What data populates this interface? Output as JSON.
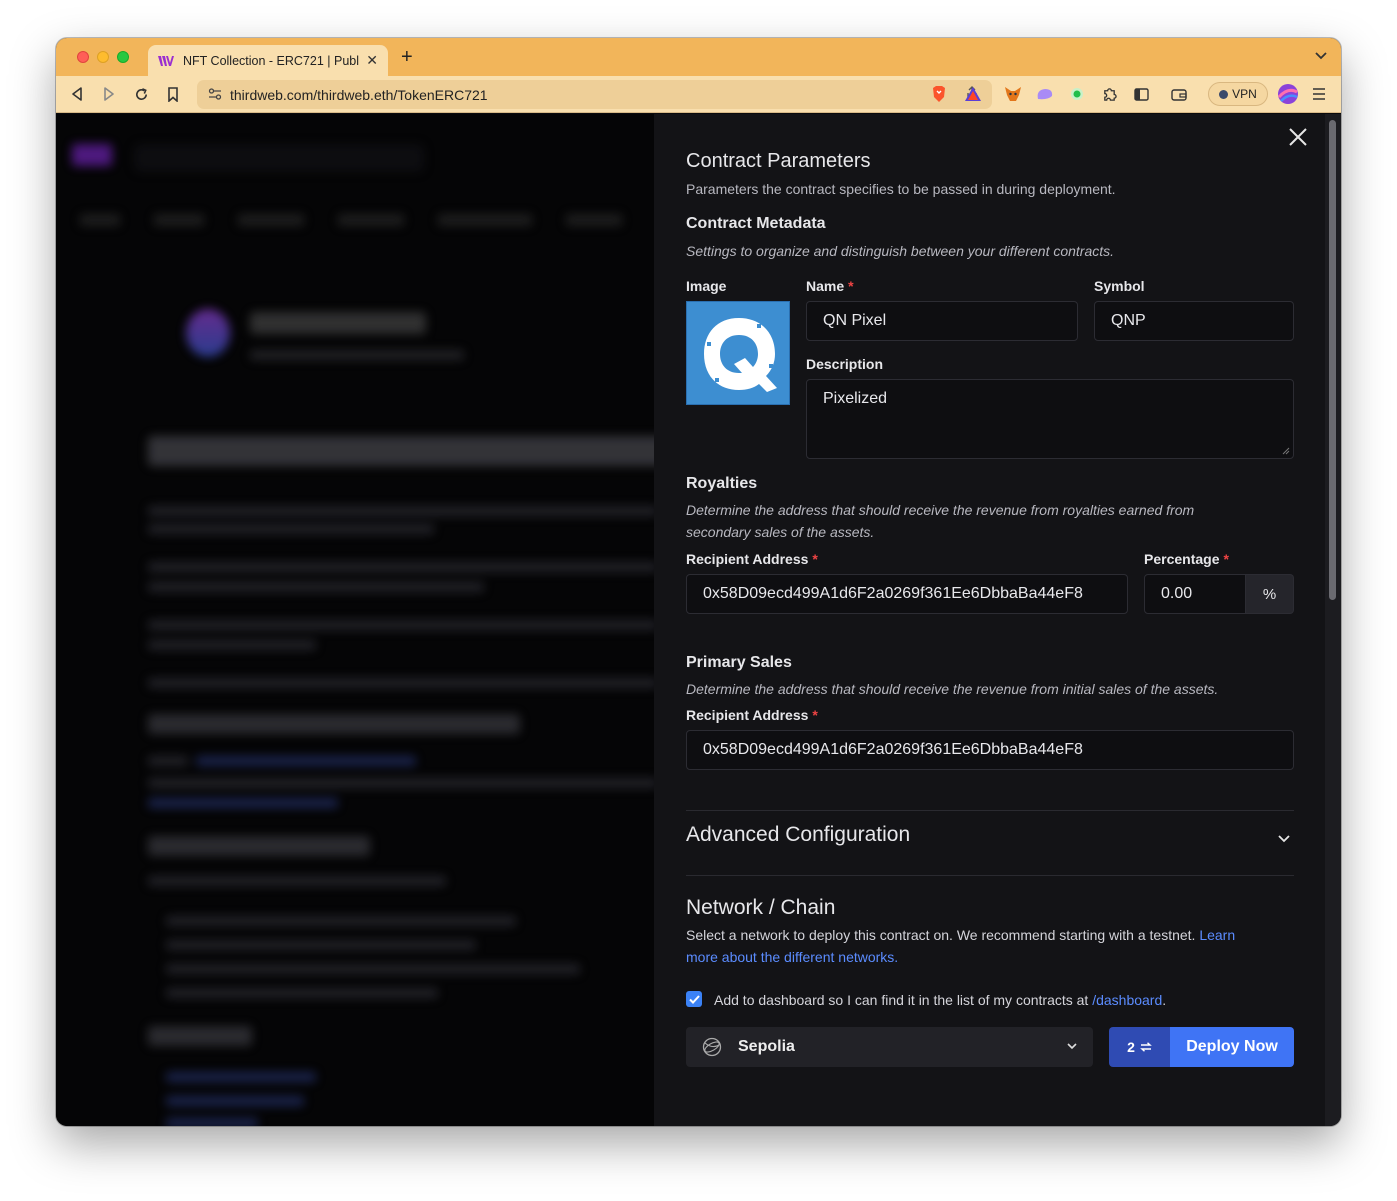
{
  "browser": {
    "tab_title": "NFT Collection - ERC721 | Publ",
    "url": "thirdweb.com/thirdweb.eth/TokenERC721",
    "vpn_label": "VPN"
  },
  "colors": {
    "tabstrip": "#f2b55a",
    "drawer_bg": "#131316",
    "primary_button": "#3f74f5",
    "link": "#5b8cff",
    "required": "#ef4444"
  },
  "drawer": {
    "title": "Contract Parameters",
    "subtitle": "Parameters the contract specifies to be passed in during deployment.",
    "metadata": {
      "title": "Contract Metadata",
      "description": "Settings to organize and distinguish between your different contracts.",
      "image_label": "Image",
      "name_label": "Name",
      "name_value": "QN Pixel",
      "symbol_label": "Symbol",
      "symbol_value": "QNP",
      "description_label": "Description",
      "description_value": "Pixelized",
      "required_mark": "*"
    },
    "royalties": {
      "title": "Royalties",
      "description_line1": "Determine the address that should receive the revenue from royalties earned from",
      "description_line2": "secondary sales of the assets.",
      "recipient_label": "Recipient Address",
      "recipient_value": "0x58D09ecd499A1d6F2a0269f361Ee6DbbaBa44eF8",
      "percentage_label": "Percentage",
      "percentage_value": "0.00",
      "percentage_unit": "%"
    },
    "primary_sales": {
      "title": "Primary Sales",
      "description": "Determine the address that should receive the revenue from initial sales of the assets.",
      "recipient_label": "Recipient Address",
      "recipient_value": "0x58D09ecd499A1d6F2a0269f361Ee6DbbaBa44eF8"
    },
    "advanced": {
      "title": "Advanced Configuration"
    },
    "network": {
      "title": "Network / Chain",
      "description_text": "Select a network to deploy this contract on. We recommend starting with a testnet.",
      "learn_link_part1": "Learn",
      "learn_link_part2": "more about the different networks.",
      "checkbox_text": "Add to dashboard so I can find it in the list of my contracts at",
      "checkbox_link": "/dashboard",
      "checkbox_period": ".",
      "selected_network": "Sepolia",
      "deploy_count": "2",
      "deploy_label": "Deploy Now"
    }
  }
}
